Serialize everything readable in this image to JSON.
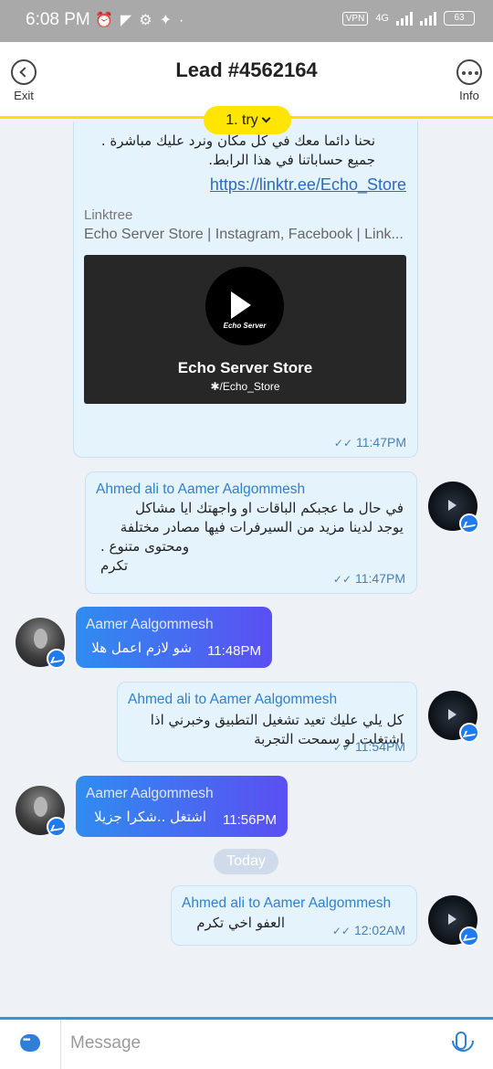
{
  "status_bar": {
    "time": "6:08 PM",
    "vpn": "VPN",
    "network": "4G",
    "battery": "63"
  },
  "header": {
    "title": "Lead #4562164",
    "back_label": "Exit",
    "info_label": "Info",
    "dropdown_label": "1. try"
  },
  "messages": [
    {
      "type": "outgoing_link",
      "text_lines": [
        "نحنا دائما معك في كل مكان ونرد عليك مباشرة .",
        "جميع حساباتنا في هذا الرابط."
      ],
      "link": "https://linktr.ee/Echo_Store",
      "preview_site": "Linktree",
      "preview_title": "Echo Server Store | Instagram, Facebook | Link...",
      "preview_logo_text": "Echo Server",
      "preview_name": "Echo Server Store",
      "preview_handle": "✱/Echo_Store",
      "time": "11:47PM"
    },
    {
      "type": "outgoing",
      "sender": "Ahmed ali to Aamer Aalgommesh",
      "text_lines": [
        "في حال ما عجبكم الباقات او واجهتك ايا مشاكل",
        "يوجد لدينا مزيد من السيرفرات فيها مصادر مختلفة",
        "ومحتوى متنوع .",
        "تكرم"
      ],
      "time": "11:47PM"
    },
    {
      "type": "incoming",
      "sender": "Aamer Aalgommesh",
      "text": "شو لازم اعمل هلا",
      "time": "11:48PM"
    },
    {
      "type": "outgoing",
      "sender": "Ahmed ali to Aamer Aalgommesh",
      "text_lines": [
        "كل يلي عليك تعيد تشغيل التطبيق وخبرني اذا",
        "اشتغلت لو سمحت التجربة"
      ],
      "time": "11:54PM"
    },
    {
      "type": "incoming",
      "sender": "Aamer Aalgommesh",
      "text": "اشتغل ..شكرا جزيلا",
      "time": "11:56PM"
    },
    {
      "type": "date_separator",
      "label": "Today"
    },
    {
      "type": "outgoing",
      "sender": "Ahmed ali to Aamer Aalgommesh",
      "text_lines": [
        "العفو اخي تكرم"
      ],
      "time": "12:02AM"
    }
  ],
  "input": {
    "placeholder": "Message"
  },
  "colors": {
    "accent_yellow": "#ffe000",
    "bubble_out": "#e5f3fd",
    "bubble_in_start": "#2f8cf0",
    "bubble_in_end": "#5b4ff2",
    "link": "#2c6ac4"
  }
}
